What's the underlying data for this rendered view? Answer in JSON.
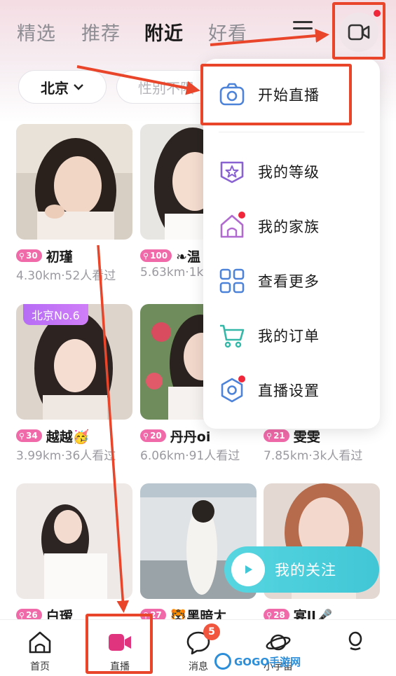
{
  "tabs": [
    "精选",
    "推荐",
    "附近",
    "好看"
  ],
  "active_tab": "附近",
  "filters": {
    "city": "北京",
    "second": "性别不限"
  },
  "dropdown": {
    "items": [
      {
        "label": "开始直播",
        "icon": "camera-icon"
      },
      {
        "label": "我的等级",
        "icon": "level-star-icon"
      },
      {
        "label": "我的家族",
        "icon": "family-house-icon"
      },
      {
        "label": "查看更多",
        "icon": "grid-more-icon"
      },
      {
        "label": "我的订单",
        "icon": "cart-icon"
      },
      {
        "label": "直播设置",
        "icon": "settings-hex-icon"
      }
    ]
  },
  "cards": [
    {
      "level": "30",
      "name": "初瑾",
      "meta": "4.30km·52人看过"
    },
    {
      "level": "100",
      "name": "❧温",
      "meta": "5.63km·1k"
    },
    {
      "badge": "北京No.6",
      "level": "34",
      "name": "越越🥳",
      "meta": "3.99km·36人看过"
    },
    {
      "level": "20",
      "name": "丹丹oi",
      "meta": "6.06km·91人看过"
    },
    {
      "level": "21",
      "name": "雯雯",
      "meta": "7.85km·3k人看过"
    },
    {
      "level": "26",
      "name": "白瑷",
      "meta": ""
    },
    {
      "level": "27",
      "name": "🐯黑暗ㄤ",
      "meta": ""
    },
    {
      "level": "28",
      "name": "宴ll🎤",
      "meta": ""
    }
  ],
  "follow_button": "我的关注",
  "bottom_nav": [
    {
      "label": "首页",
      "icon": "home-icon"
    },
    {
      "label": "直播",
      "icon": "live-camera-icon"
    },
    {
      "label": "消息",
      "icon": "message-icon"
    },
    {
      "label": "小宇宙",
      "icon": "planet-icon"
    },
    {
      "label": "",
      "icon": "profile-icon"
    }
  ],
  "message_badge": "5",
  "watermark": "GOGO手游网",
  "colors": {
    "accent_pink": "#f06aa9",
    "live_pink": "#e0347f",
    "follow_cyan": "#41c6d6",
    "annotation_red": "#e8452b",
    "notify_red": "#f0263a"
  }
}
